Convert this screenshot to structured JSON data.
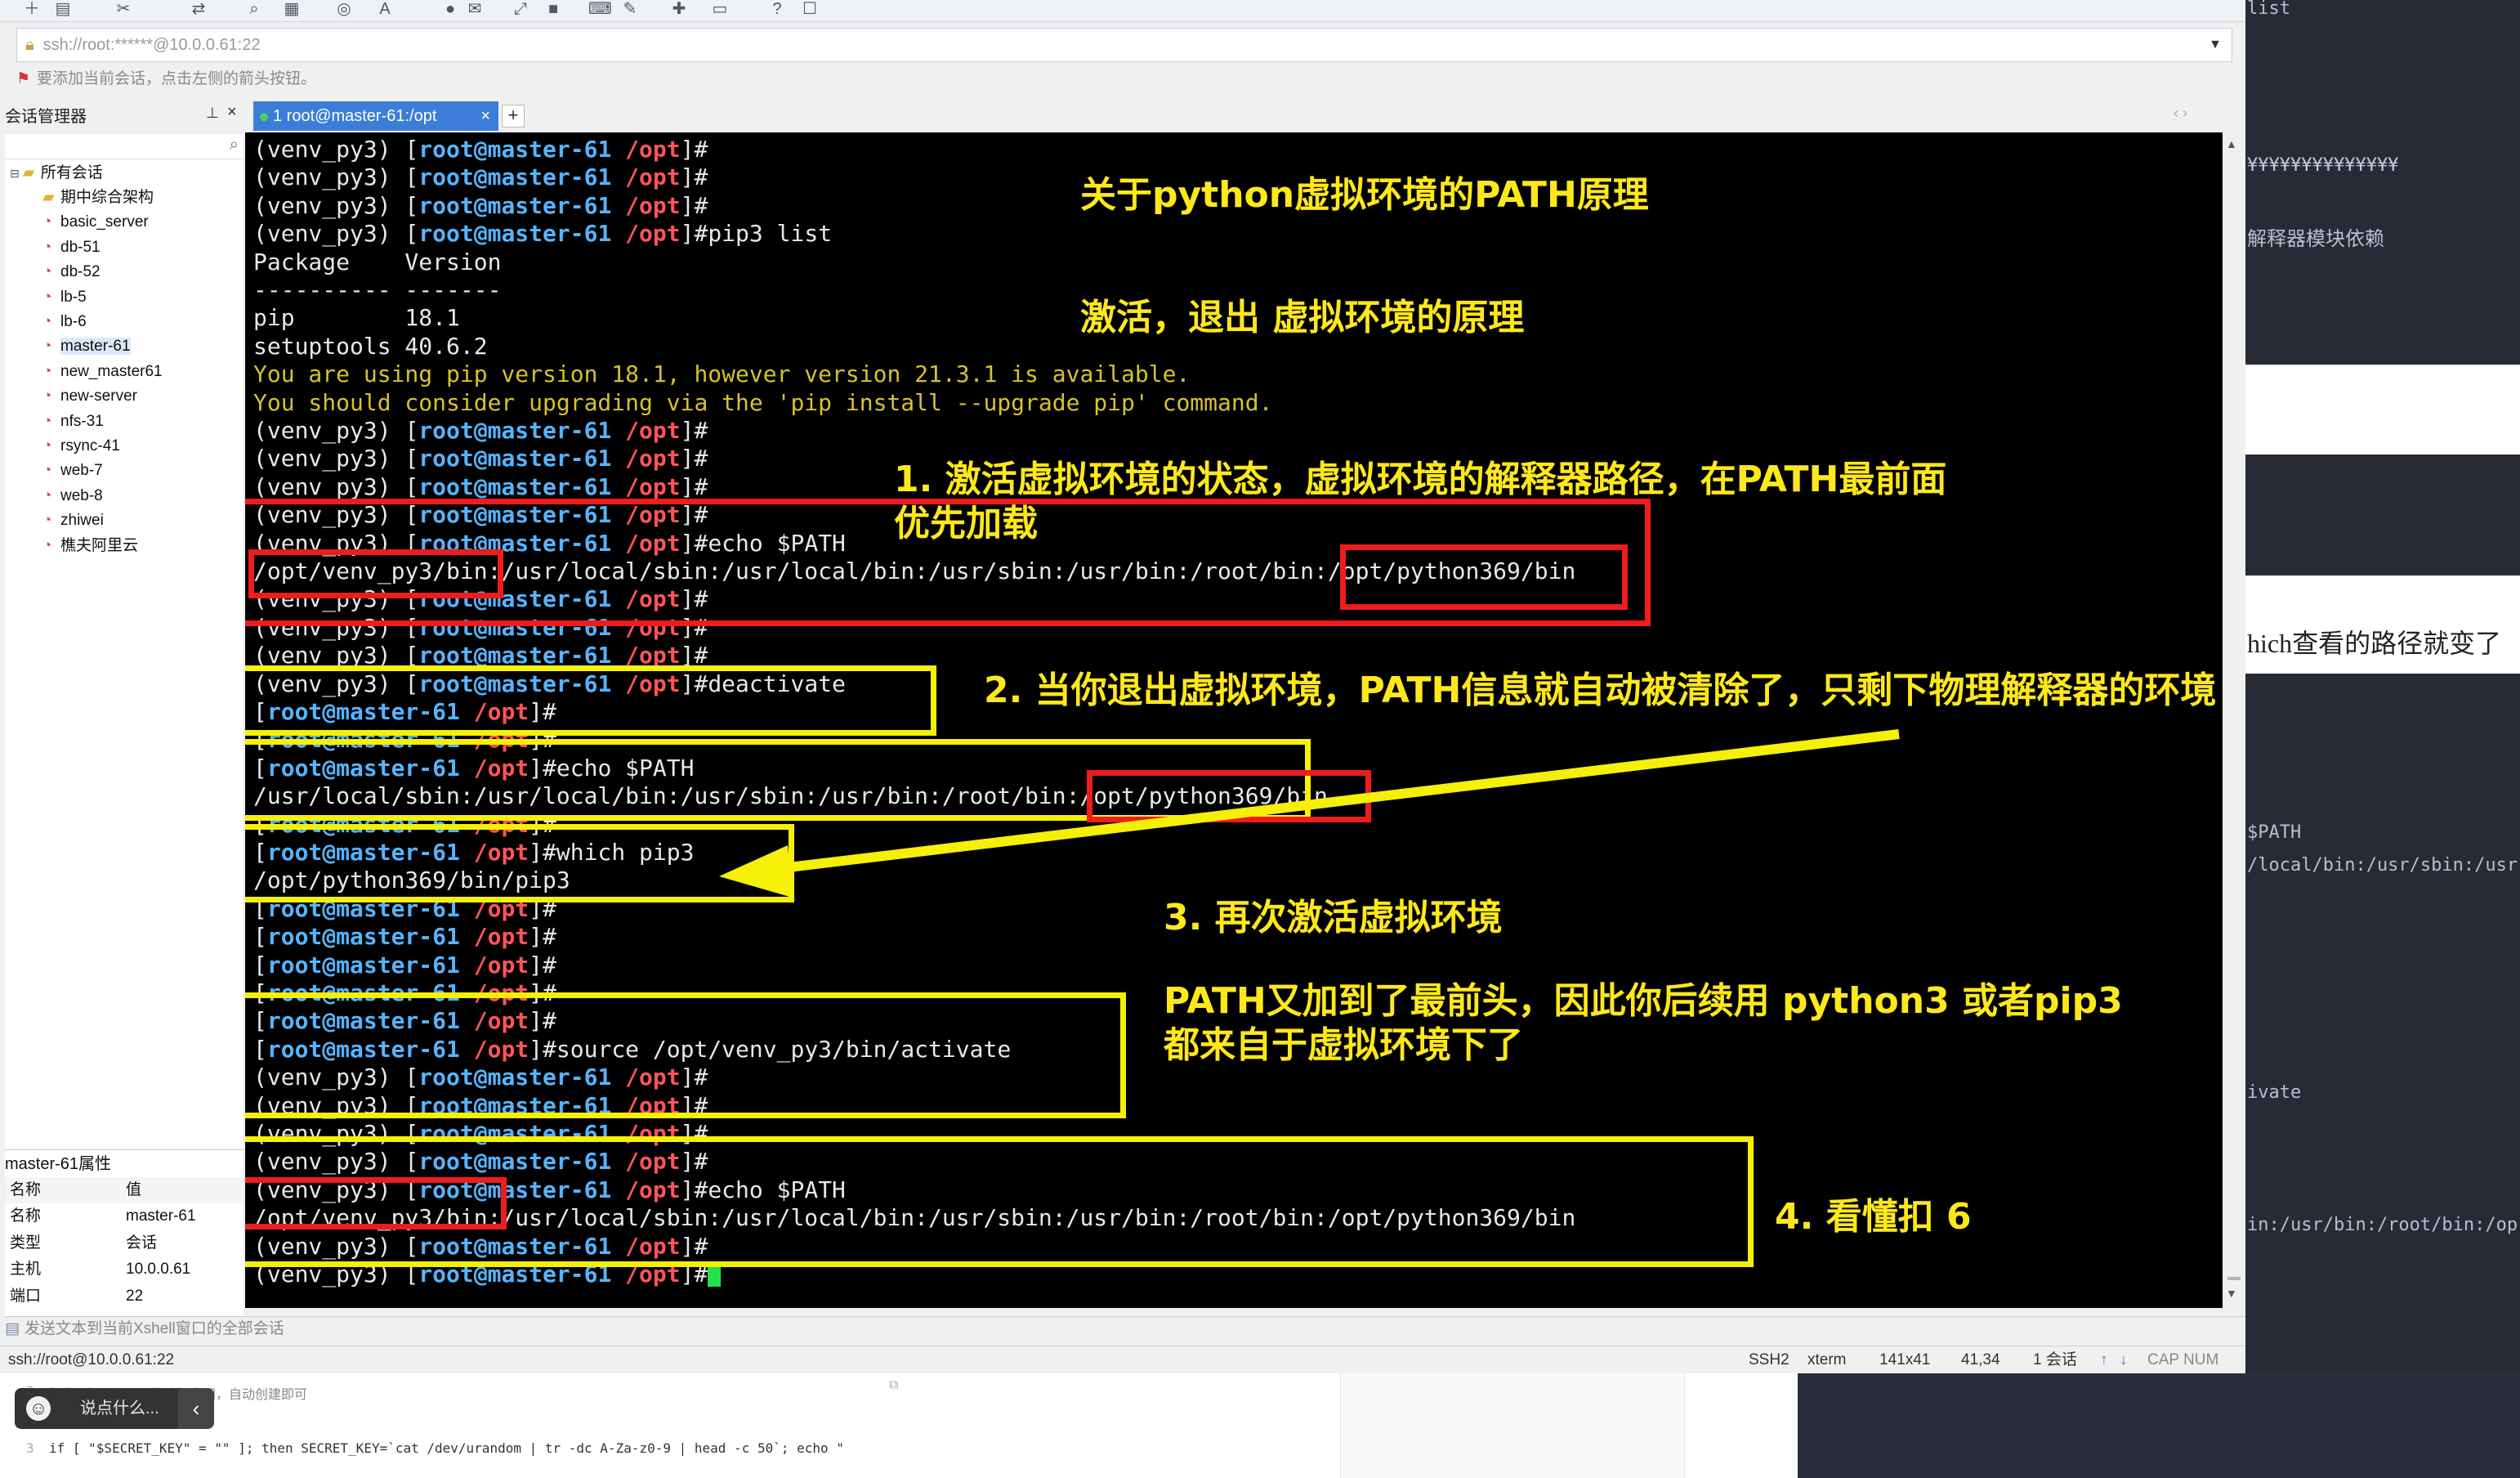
{
  "window": {
    "address": "ssh://root:******@10.0.0.61:22",
    "hint": "要添加当前会话，点击左侧的箭头按钮。"
  },
  "session_manager": {
    "title": "会话管理器",
    "pin_icon": "pin-icon",
    "close_label": "×",
    "root": "所有会话",
    "items": [
      {
        "label": "期中综合架构",
        "icon": "folder-icon"
      },
      {
        "label": "basic_server",
        "icon": "session-icon"
      },
      {
        "label": "db-51",
        "icon": "session-icon"
      },
      {
        "label": "db-52",
        "icon": "session-icon"
      },
      {
        "label": "lb-5",
        "icon": "session-icon"
      },
      {
        "label": "lb-6",
        "icon": "session-icon"
      },
      {
        "label": "master-61",
        "icon": "session-icon"
      },
      {
        "label": "new_master61",
        "icon": "session-icon"
      },
      {
        "label": "new-server",
        "icon": "session-icon"
      },
      {
        "label": "nfs-31",
        "icon": "session-icon"
      },
      {
        "label": "rsync-41",
        "icon": "session-icon"
      },
      {
        "label": "web-7",
        "icon": "session-icon"
      },
      {
        "label": "web-8",
        "icon": "session-icon"
      },
      {
        "label": "zhiwei",
        "icon": "session-icon"
      },
      {
        "label": "樵夫阿里云",
        "icon": "session-icon"
      }
    ]
  },
  "properties": {
    "title": "master-61属性",
    "header": {
      "k": "名称",
      "v": "值"
    },
    "rows": [
      {
        "k": "名称",
        "v": "master-61"
      },
      {
        "k": "类型",
        "v": "会话"
      },
      {
        "k": "主机",
        "v": "10.0.0.61"
      },
      {
        "k": "端口",
        "v": "22"
      }
    ]
  },
  "tab": {
    "label": "1 root@master-61:/opt",
    "close": "×",
    "add": "+",
    "nav": "‹  ›"
  },
  "terminal": {
    "venv": "(venv_py3) ",
    "lb": "[",
    "rb": "]",
    "user": "root@master-61",
    "path": " /opt",
    "hash": "#",
    "cmds": {
      "pip3_list": "pip3 list",
      "echo_path": "echo $PATH",
      "deactivate": "deactivate",
      "which_pip3": "which pip3",
      "source": "source /opt/venv_py3/bin/activate"
    },
    "out": {
      "pkg_header": "Package    Version",
      "pkg_sep": "---------- -------",
      "pkg_pip": "pip        18.1",
      "pkg_setuptools": "setuptools 40.6.2",
      "warn1": "You are using pip version 18.1, however version 21.3.1 is available.",
      "warn2": "You should consider upgrading via the 'pip install --upgrade pip' command.",
      "path_venv": "/opt/venv_py3/bin:/usr/local/sbin:/usr/local/bin:/usr/sbin:/usr/bin:/root/bin:/opt/python369/bin",
      "path_plain": "/usr/local/sbin:/usr/local/bin:/usr/sbin:/usr/bin:/root/bin:/opt/python369/bin",
      "which_out": "/opt/python369/bin/pip3"
    }
  },
  "annotations": {
    "title1": "关于python虚拟环境的PATH原理",
    "title2": "激活，退出 虚拟环境的原理",
    "n1a": "1. 激活虚拟环境的状态，虚拟环境的解释器路径，在PATH最前面",
    "n1b": "优先加载",
    "n2": "2. 当你退出虚拟环境，PATH信息就自动被清除了，只剩下物理解释器的环境",
    "n3": "3. 再次激活虚拟环境",
    "n3a": "PATH又加到了最前头，因此你后续用 python3 或者pip3",
    "n3b": " 都来自于虚拟环境下了",
    "n4": "4. 看懂扣 6"
  },
  "send_bar": "发送文本到当前Xshell窗口的全部会话",
  "status": {
    "left": "ssh://root@10.0.0.61:22",
    "protocol": "SSH2",
    "term": "xterm",
    "size": "141x41",
    "pos": "41,34",
    "sessions": "1 会话",
    "caps": "CAP NUM"
  },
  "right_pane": {
    "list": "list",
    "yen": "¥¥¥¥¥¥¥¥¥¥¥¥¥¥",
    "dep": "解释器模块依赖",
    "which": "hich查看的路径就变了",
    "path1": "$PATH",
    "path2": "/local/bin:/usr/sbin:/usr",
    "ivate": "ivate",
    "bin": "in:/usr/bin:/root/bin:/op"
  },
  "bottom": {
    "comment": "生成服务运行需要的随机密钥，自动创建即可",
    "code": "if [ \"$SECRET_KEY\" = \"\" ]; then SECRET_KEY=`cat /dev/urandom | tr -dc A-Za-z0-9 | head -c 50`; echo \"",
    "line1": "3",
    "line2": "3",
    "chat_placeholder": "说点什么...",
    "chat_chevron": "‹"
  }
}
